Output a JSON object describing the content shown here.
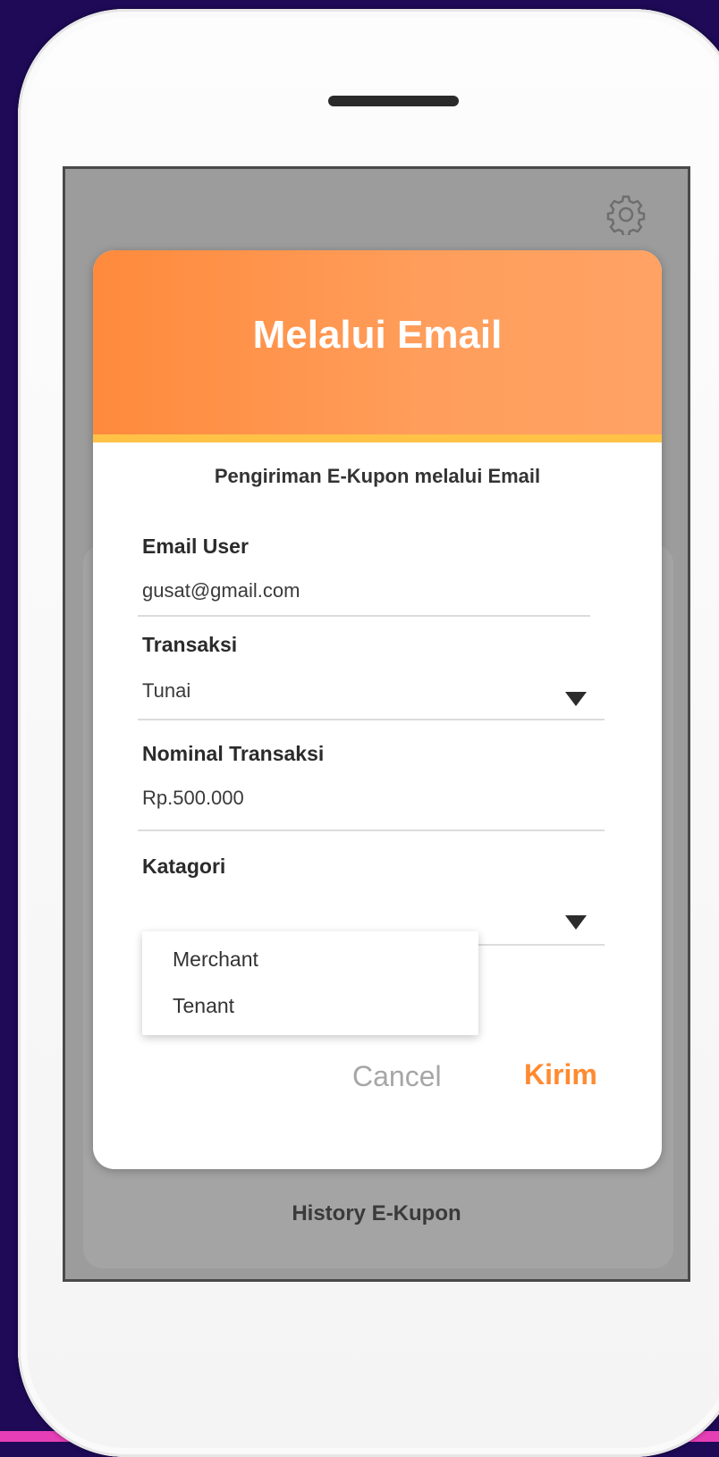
{
  "dialog": {
    "title": "Melalui Email",
    "subtitle": "Pengiriman E-Kupon melalui Email",
    "fields": {
      "email": {
        "label": "Email User",
        "value": "gusat@gmail.com"
      },
      "transaction": {
        "label": "Transaksi",
        "value": "Tunai"
      },
      "nominal": {
        "label": "Nominal Transaksi",
        "value": "Rp.500.000"
      },
      "category": {
        "label": "Katagori",
        "options": [
          "Merchant",
          "Tenant"
        ]
      }
    },
    "buttons": {
      "cancel": "Cancel",
      "send": "Kirim"
    }
  },
  "background": {
    "history_label": "History E-Kupon"
  },
  "icons": {
    "settings": "gear-icon",
    "dropdown": "caret-down-icon"
  },
  "colors": {
    "page_background": "#1e0a57",
    "header_orange": "#ff9450",
    "header_underline": "#ffc247",
    "accent_button": "#ff8a30",
    "bottom_strip": "#e63fb6"
  }
}
